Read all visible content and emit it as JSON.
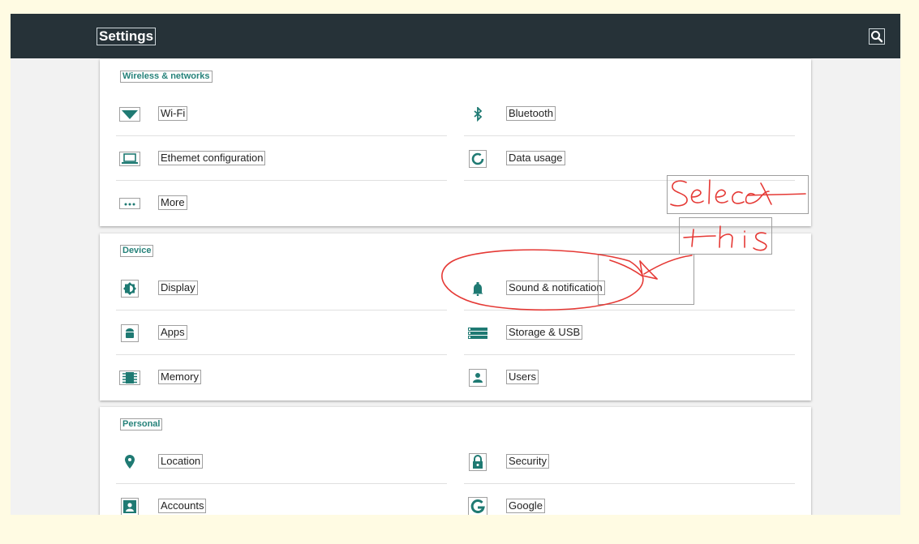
{
  "app": {
    "title": "Settings"
  },
  "sections": {
    "wireless": {
      "title": "Wireless & networks",
      "wifi": "Wi-Fi",
      "bluetooth": "Bluetooth",
      "ethernet": "Ethemet configuration",
      "data_usage": "Data usage",
      "more": "More"
    },
    "device": {
      "title": "Device",
      "display": "Display",
      "sound": "Sound & notification",
      "apps": "Apps",
      "storage": "Storage & USB",
      "memory": "Memory",
      "users": "Users"
    },
    "personal": {
      "title": "Personal",
      "location": "Location",
      "security": "Security",
      "accounts": "Accounts",
      "google": "Google"
    }
  },
  "icons": {
    "search": "search-icon",
    "wifi": "wifi-icon",
    "bluetooth": "bluetooth-icon",
    "ethernet": "laptop-icon",
    "data_usage": "data-usage-icon",
    "more": "more-dots-icon",
    "display": "brightness-icon",
    "sound": "bell-icon",
    "apps": "android-icon",
    "storage": "storage-icon",
    "memory": "memory-chip-icon",
    "users": "person-icon",
    "location": "location-pin-icon",
    "security": "lock-icon",
    "accounts": "account-box-icon",
    "google": "google-g-icon"
  },
  "colors": {
    "appbar": "#263238",
    "accent": "#26827a",
    "icon": "#1f7a73",
    "annotation": "#e53935"
  }
}
